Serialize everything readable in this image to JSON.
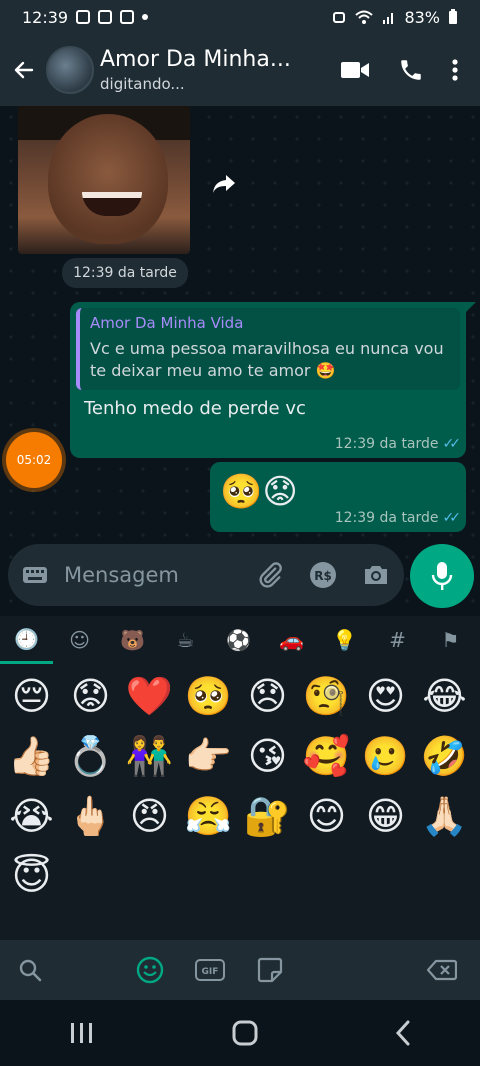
{
  "status_bar": {
    "time": "12:39",
    "battery": "83%"
  },
  "header": {
    "title": "Amor Da Minha...",
    "subtitle": "digitando..."
  },
  "messages": {
    "image_time": "12:39 da tarde",
    "reply": {
      "quoted_name": "Amor Da Minha Vida",
      "quoted_text": "Vc e uma pessoa maravilhosa eu nunca vou te deixar meu amo te amor 🤩",
      "text": "Tenho medo de perde vc",
      "time": "12:39 da tarde"
    },
    "emoji_msg": {
      "text": "🥺😟",
      "time": "12:39 da tarde"
    }
  },
  "floating_timer": "05:02",
  "input": {
    "placeholder": "Mensagem"
  },
  "emoji_keyboard": {
    "categories": [
      "recent",
      "smileys",
      "animals",
      "food",
      "activity",
      "travel",
      "objects",
      "symbols",
      "flags"
    ],
    "emojis": [
      "😔",
      "😟",
      "❤️",
      "🥺",
      "😞",
      "🧐",
      "😍",
      "😂",
      "👍🏻",
      "💍",
      "👫",
      "👉🏻",
      "😘",
      "🥰",
      "🥲",
      "🤣",
      "😭",
      "🖕🏻",
      "😠",
      "😤",
      "🔐",
      "😊",
      "😁",
      "🙏🏻",
      "😇"
    ]
  },
  "colors": {
    "accent": "#00a884",
    "outgoing_bubble": "#005c4b",
    "timer": "#f57c00",
    "quote_name": "#a78bfa"
  }
}
